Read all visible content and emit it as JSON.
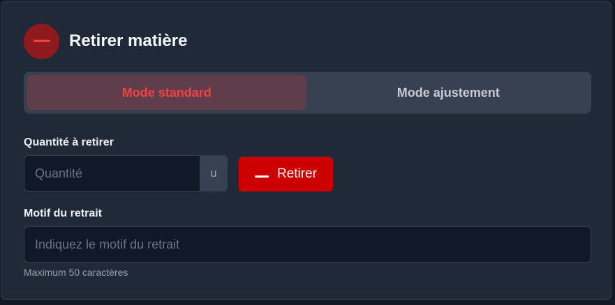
{
  "header": {
    "title": "Retirer matière",
    "icon": "minus-icon"
  },
  "tabs": [
    {
      "label": "Mode standard",
      "active": true
    },
    {
      "label": "Mode ajustement",
      "active": false
    }
  ],
  "quantity": {
    "label": "Quantité à retirer",
    "placeholder": "Quantité",
    "value": "",
    "unit": "u"
  },
  "submit": {
    "label": "Retirer",
    "icon": "minus-icon"
  },
  "motif": {
    "label": "Motif du retrait",
    "placeholder": "Indiquez le motif du retrait",
    "value": "",
    "hint": "Maximum 50 caractères"
  },
  "colors": {
    "accent": "#cc0000",
    "accent_text": "#ef4444",
    "icon_bg": "#8e1a1d",
    "card_bg": "#1f2937",
    "input_bg": "#111827"
  }
}
